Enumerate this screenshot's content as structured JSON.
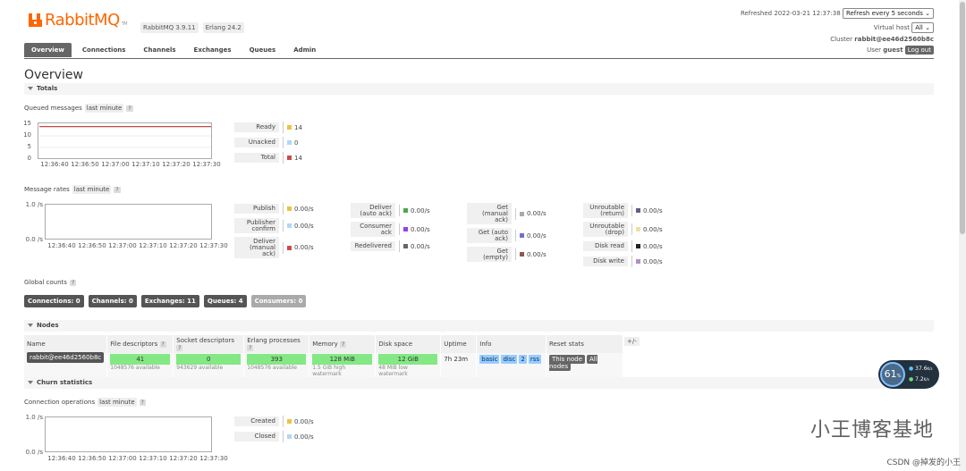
{
  "app": {
    "logo_text": "RabbitMQ",
    "tm": "TM",
    "version": "RabbitMQ 3.9.11",
    "erlang": "Erlang 24.2"
  },
  "header": {
    "refreshed": "Refreshed 2022-03-21 12:37:38",
    "refresh_option": "Refresh every 5 seconds",
    "virtual_host_label": "Virtual host",
    "virtual_host_value": "All",
    "cluster_label": "Cluster",
    "cluster_value": "rabbit@ee46d2560b8c",
    "user_label": "User",
    "user_value": "guest",
    "logout": "Log out"
  },
  "tabs": [
    "Overview",
    "Connections",
    "Channels",
    "Exchanges",
    "Queues",
    "Admin"
  ],
  "page_title": "Overview",
  "totals": {
    "title": "Totals",
    "queued_label": "Queued messages",
    "range": "last minute",
    "help": "?",
    "queued_legend": [
      {
        "label": "Ready",
        "value": "14",
        "color": "#edc240"
      },
      {
        "label": "Unacked",
        "value": "0",
        "color": "#afd8f8"
      },
      {
        "label": "Total",
        "value": "14",
        "color": "#cb4b4b"
      }
    ],
    "rates_label": "Message rates",
    "rates_col1": [
      {
        "label": "Publish",
        "value": "0.00/s",
        "color": "#edc240"
      },
      {
        "label": "Publisher confirm",
        "value": "0.00/s",
        "color": "#afd8f8"
      },
      {
        "label": "Deliver (manual ack)",
        "value": "0.00/s",
        "color": "#cb4b4b"
      }
    ],
    "rates_col2": [
      {
        "label": "Deliver (auto ack)",
        "value": "0.00/s",
        "color": "#4da74d"
      },
      {
        "label": "Consumer ack",
        "value": "0.00/s",
        "color": "#9440ed"
      },
      {
        "label": "Redelivered",
        "value": "0.00/s",
        "color": "#666666"
      }
    ],
    "rates_col3": [
      {
        "label": "Get (manual ack)",
        "value": "0.00/s",
        "color": "#aaaaaa"
      },
      {
        "label": "Get (auto ack)",
        "value": "0.00/s",
        "color": "#7070cc"
      },
      {
        "label": "Get (empty)",
        "value": "0.00/s",
        "color": "#8c5a4a"
      }
    ],
    "rates_col4": [
      {
        "label": "Unroutable (return)",
        "value": "0.00/s",
        "color": "#606080"
      },
      {
        "label": "Unroutable (drop)",
        "value": "0.00/s",
        "color": "#f0e0a0"
      },
      {
        "label": "Disk read",
        "value": "0.00/s",
        "color": "#222222"
      },
      {
        "label": "Disk write",
        "value": "0.00/s",
        "color": "#b090c0"
      }
    ],
    "global_label": "Global counts",
    "global_counts": [
      {
        "label": "Connections: 0",
        "light": false
      },
      {
        "label": "Channels: 0",
        "light": false
      },
      {
        "label": "Exchanges: 11",
        "light": false
      },
      {
        "label": "Queues: 4",
        "light": false
      },
      {
        "label": "Consumers: 0",
        "light": true
      }
    ]
  },
  "chart_data": [
    {
      "type": "line",
      "title": "Queued messages",
      "x": [
        "12:36:40",
        "12:36:50",
        "12:37:00",
        "12:37:10",
        "12:37:20",
        "12:37:30"
      ],
      "yticks": [
        "15",
        "10",
        "5",
        "0"
      ],
      "ylim": [
        0,
        15
      ],
      "series": [
        {
          "name": "Ready",
          "values": [
            14,
            14,
            14,
            14,
            14,
            14
          ]
        },
        {
          "name": "Unacked",
          "values": [
            0,
            0,
            0,
            0,
            0,
            0
          ]
        },
        {
          "name": "Total",
          "values": [
            14,
            14,
            14,
            14,
            14,
            14
          ]
        }
      ]
    },
    {
      "type": "line",
      "title": "Message rates",
      "x": [
        "12:36:40",
        "12:36:50",
        "12:37:00",
        "12:37:10",
        "12:37:20",
        "12:37:30"
      ],
      "yticks": [
        "1.0 /s",
        "0.0 /s"
      ],
      "ylim": [
        0,
        1
      ]
    },
    {
      "type": "line",
      "title": "Connection operations",
      "x": [
        "12:36:40",
        "12:36:50",
        "12:37:00",
        "12:37:10",
        "12:37:20",
        "12:37:30"
      ],
      "yticks": [
        "1.0 /s",
        "0.0 /s"
      ],
      "ylim": [
        0,
        1
      ]
    }
  ],
  "nodes": {
    "title": "Nodes",
    "headers": [
      "Name",
      "File descriptors",
      "Socket descriptors",
      "Erlang processes",
      "Memory",
      "Disk space",
      "Uptime",
      "Info",
      "Reset stats"
    ],
    "header_help": [
      "",
      "?",
      "?",
      "?",
      "?",
      "",
      "",
      "",
      ""
    ],
    "plusminus": "+/-",
    "row": {
      "name": "rabbit@ee46d2560b8c",
      "fd": "41",
      "fd_sub": "1048576 available",
      "sd": "0",
      "sd_sub": "943629 available",
      "ep": "393",
      "ep_sub": "1048576 available",
      "mem": "128 MiB",
      "mem_sub": "1.5 GiB high watermark",
      "disk": "12 GiB",
      "disk_sub": "48 MiB low watermark",
      "uptime": "7h 23m",
      "info": [
        "basic",
        "disc",
        "2",
        "rss"
      ],
      "reset": [
        "This node",
        "All nodes"
      ]
    }
  },
  "churn": {
    "title": "Churn statistics",
    "conn_label": "Connection operations",
    "range": "last minute",
    "help": "?",
    "legend": [
      {
        "label": "Created",
        "value": "0.00/s",
        "color": "#edc240"
      },
      {
        "label": "Closed",
        "value": "0.00/s",
        "color": "#afd8f8"
      }
    ]
  },
  "widget": {
    "pct": "61",
    "pct_unit": "%",
    "up": "37.6",
    "up_unit": "K/s",
    "down": "7.2",
    "down_unit": "K/s"
  },
  "watermark": "小王博客基地",
  "credit": "CSDN @掉发的小王"
}
